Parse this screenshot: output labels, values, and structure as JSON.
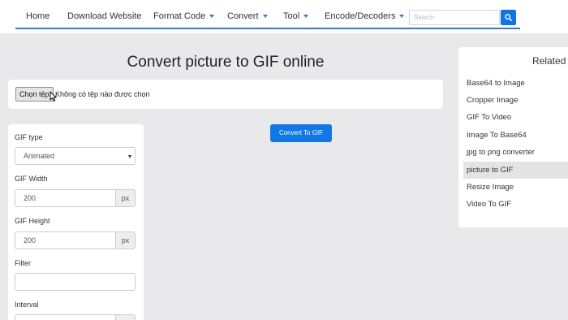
{
  "nav": {
    "items": [
      {
        "label": "Home",
        "dropdown": false
      },
      {
        "label": "Download Website",
        "dropdown": false
      },
      {
        "label": "Format Code",
        "dropdown": true
      },
      {
        "label": "Convert",
        "dropdown": true
      },
      {
        "label": "Tool",
        "dropdown": true
      },
      {
        "label": "Encode/Decoders",
        "dropdown": true
      }
    ],
    "search_placeholder": "Search"
  },
  "page": {
    "title": "Convert picture to GIF online"
  },
  "file_input": {
    "button_label": "Chọn tệp",
    "status": "Không có tệp nào được chọn"
  },
  "convert_button": "Convert To GIF",
  "options": {
    "gif_type_label": "GIF type",
    "gif_type_value": "Animated",
    "width_label": "GIF Width",
    "width_value": "200",
    "width_unit": "px",
    "height_label": "GIF Height",
    "height_value": "200",
    "height_unit": "px",
    "filter_label": "Filter",
    "filter_value": "",
    "interval_label": "Interval"
  },
  "related": {
    "title": "Related",
    "items": [
      {
        "label": "Base64 to Image"
      },
      {
        "label": "Cropper Image"
      },
      {
        "label": "GIF To Video"
      },
      {
        "label": "Image To Base64"
      },
      {
        "label": "jpg to png converter"
      },
      {
        "label": "picture to GIF",
        "active": true
      },
      {
        "label": "Resize Image"
      },
      {
        "label": "Video To GIF"
      }
    ]
  },
  "colors": {
    "accent": "#1177e6",
    "nav_underline": "#3a78c2",
    "page_background": "#e9e9eb"
  }
}
